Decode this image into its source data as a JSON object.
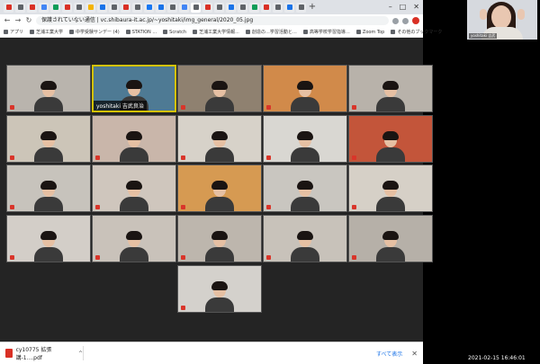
{
  "browser": {
    "tabs": [
      {
        "name": "gmail-tab",
        "color": "#d93025"
      },
      {
        "name": "tab-2",
        "color": "#5f6368"
      },
      {
        "name": "tab-3",
        "color": "#d93025"
      },
      {
        "name": "tab-4",
        "color": "#4285f4"
      },
      {
        "name": "tab-5",
        "color": "#0f9d58"
      },
      {
        "name": "tab-6",
        "color": "#d93025"
      },
      {
        "name": "tab-7",
        "color": "#5f6368"
      },
      {
        "name": "tab-8",
        "color": "#f4b400"
      },
      {
        "name": "tab-9",
        "color": "#1a73e8"
      },
      {
        "name": "tab-10",
        "color": "#5f6368"
      },
      {
        "name": "tab-11",
        "color": "#d93025"
      },
      {
        "name": "tab-12",
        "color": "#5f6368"
      },
      {
        "name": "tab-13",
        "color": "#1877f2"
      },
      {
        "name": "tab-14",
        "color": "#1a73e8"
      },
      {
        "name": "tab-15",
        "color": "#5f6368"
      },
      {
        "name": "tab-16",
        "color": "#4285f4"
      },
      {
        "name": "tab-17",
        "color": "#5f6368"
      },
      {
        "name": "tab-18",
        "color": "#d93025"
      },
      {
        "name": "tab-19",
        "color": "#5f6368"
      },
      {
        "name": "tab-20",
        "color": "#1a73e8"
      },
      {
        "name": "tab-21",
        "color": "#5f6368"
      },
      {
        "name": "tab-22",
        "color": "#0f9d58"
      },
      {
        "name": "tab-23",
        "color": "#d93025"
      },
      {
        "name": "tab-24",
        "color": "#5f6368"
      },
      {
        "name": "tab-25",
        "color": "#1a73e8"
      },
      {
        "name": "tab-26",
        "color": "#5f6368"
      }
    ],
    "new_tab": "+",
    "window_controls": {
      "minimize": "–",
      "maximize": "□",
      "close": "✕"
    },
    "nav": {
      "back": "←",
      "forward": "→",
      "reload": "↻"
    },
    "omnibox_text": "保護されていない通信 | vc.shibaura-it.ac.jp/~yoshitaki/img_general/2020_05.jpg",
    "bookmarks": [
      "アプリ",
      "芝浦工業大学",
      "中学受験サンデー (4)",
      "STATION ...",
      "Scratch",
      "芝浦工業大学情報...",
      "創造の…学習活動と…",
      "高等学校学習指導…",
      "Zoom Top",
      "その他のブックマーク"
    ]
  },
  "meeting": {
    "participants": [
      {
        "name": ""
      },
      {
        "name": "yoshitaki 吉武良治"
      },
      {
        "name": ""
      },
      {
        "name": ""
      },
      {
        "name": ""
      },
      {
        "name": ""
      },
      {
        "name": ""
      },
      {
        "name": ""
      },
      {
        "name": ""
      },
      {
        "name": ""
      },
      {
        "name": ""
      },
      {
        "name": ""
      },
      {
        "name": ""
      },
      {
        "name": ""
      },
      {
        "name": ""
      },
      {
        "name": ""
      },
      {
        "name": ""
      },
      {
        "name": ""
      },
      {
        "name": ""
      },
      {
        "name": ""
      },
      {
        "name": ""
      }
    ],
    "tile_colors": [
      "#b9b4ad",
      "#4e7a94",
      "#8f8170",
      "#d18a4a",
      "#b8b2aa",
      "#ccc5b8",
      "#c9b6aa",
      "#d7d2c9",
      "#d9d7d2",
      "#c3553a",
      "#c7c3bc",
      "#cfc6bd",
      "#d69a52",
      "#c9c6c0",
      "#d6d0c7",
      "#d3cec8",
      "#c9c2ba",
      "#bdb6ad",
      "#c8c2ba",
      "#b6b0a8",
      "#d4d1cc"
    ]
  },
  "download": {
    "file_name": "cy10775 拡張講-1....pdf",
    "show_all": "すべて表示",
    "close": "✕"
  },
  "self_view": {
    "name": "yoshitaki 吉武"
  },
  "taskbar": {
    "clock": "2021-02-15  16:46:01"
  }
}
